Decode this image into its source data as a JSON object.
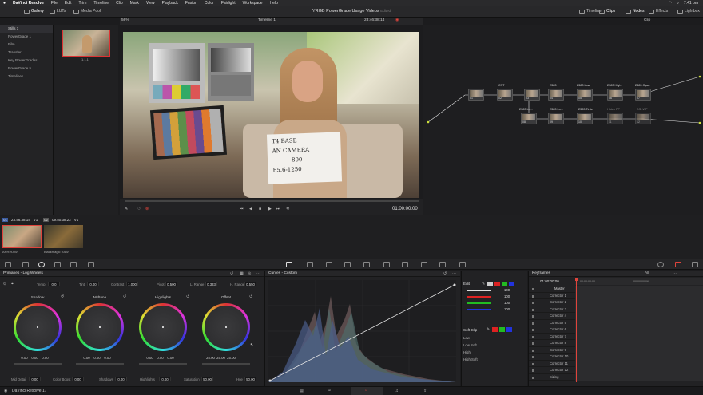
{
  "menubar": {
    "app": "DaVinci Resolve",
    "items": [
      "File",
      "Edit",
      "Trim",
      "Timeline",
      "Clip",
      "Mark",
      "View",
      "Playback",
      "Fusion",
      "Color",
      "Fairlight",
      "Workspace",
      "Help"
    ],
    "clock": "7:41 pm"
  },
  "topbar": {
    "gallery": "Gallery",
    "luts": "LUTs",
    "media_pool": "Media Pool",
    "zoom": "56%",
    "timeline_name": "Timeline 1",
    "timecode": "23:46:38:14",
    "project_title": "YRGB PowerGrade Usage Videos",
    "edited": "Edited",
    "timeline": "Timeline",
    "clips": "Clips",
    "nodes": "Nodes",
    "effects": "Effects",
    "lightbox": "Lightbox",
    "clip_mode": "Clip"
  },
  "stills": {
    "albums": [
      "Stills 1",
      "PowerGrade 1",
      "Film",
      "Transfer",
      "Key PowerGrades",
      "PowerGrade 5",
      "Timelines"
    ],
    "thumb_label": "1.1.1"
  },
  "viewer": {
    "timecode": "01:00:00:00",
    "sign_lines": [
      "T4 BASE",
      "AN CAMERA",
      "800",
      "F5.6-1250"
    ]
  },
  "nodes": [
    {
      "label": "",
      "num": "01"
    },
    {
      "label": "CST",
      "num": "02"
    },
    {
      "label": "",
      "num": "03"
    },
    {
      "label": "2383",
      "num": "04"
    },
    {
      "label": "2383 Low",
      "num": "05"
    },
    {
      "label": "2383 High",
      "num": "06"
    },
    {
      "label": "2383 Cyan",
      "num": "07"
    },
    {
      "label": "2383 Lo...",
      "num": "08"
    },
    {
      "label": "2383 Tints",
      "num": "09"
    },
    {
      "label": "2383 Tint",
      "num": "10"
    },
    {
      "label": "Hutch PP",
      "num": "11"
    },
    {
      "label": "DSI-WP",
      "num": "12"
    }
  ],
  "clips": [
    {
      "num": "01",
      "timecode": "23:46:38:14",
      "track": "V1",
      "codec": "ARRIRAW"
    },
    {
      "num": "02",
      "timecode": "09:50:38:22",
      "track": "V1",
      "codec": "Blackmagic RAW"
    }
  ],
  "primaries": {
    "title": "Primaries - Log Wheels",
    "temp_label": "Temp",
    "temp": "0.0",
    "tint_label": "Tint",
    "tint": "0.00",
    "contrast_label": "Contrast",
    "contrast": "1.000",
    "pivot_label": "Pivot",
    "pivot": "0.500",
    "lrange_label": "L. Range",
    "lrange": "0.333",
    "hrange_label": "H. Range",
    "hrange": "0.550",
    "wheels": [
      {
        "name": "Shadow",
        "vals": [
          "0.00",
          "0.00",
          "0.00"
        ]
      },
      {
        "name": "Midtone",
        "vals": [
          "0.00",
          "0.00",
          "0.00"
        ]
      },
      {
        "name": "Highlights",
        "vals": [
          "0.00",
          "0.00",
          "0.00"
        ]
      },
      {
        "name": "Offset",
        "vals": [
          "25.00",
          "25.00",
          "25.00"
        ]
      }
    ],
    "middetail_label": "Mid Detail",
    "middetail": "0.00",
    "colorboost_label": "Color Boost",
    "colorboost": "0.00",
    "shadows_label": "Shadows",
    "shadows": "0.00",
    "highlights_label": "Highlights",
    "highlights": "0.00",
    "saturation_label": "Saturation",
    "saturation": "50.00",
    "hue_label": "Hue",
    "hue": "50.00"
  },
  "curves": {
    "title": "Curves - Custom"
  },
  "edit": {
    "title": "Edit",
    "values": [
      "100",
      "100",
      "100",
      "100"
    ],
    "soft_clip": "Soft Clip",
    "low": "Low",
    "low_soft": "Low Soft",
    "high": "High",
    "high_soft": "High Soft"
  },
  "keyframes": {
    "title": "Keyframes",
    "filter": "All",
    "tc_main": "01:00:00:00",
    "tc_start": "00:00:00:00",
    "tc_end": "00:00:00:06",
    "rows": [
      "Master",
      "Corrector 1",
      "Corrector 2",
      "Corrector 3",
      "Corrector 4",
      "Corrector 5",
      "Corrector 6",
      "Corrector 7",
      "Corrector 8",
      "Corrector 9",
      "Corrector 10",
      "Corrector 11",
      "Corrector 12",
      "Sizing"
    ]
  },
  "bottombar": {
    "app": "DaVinci Resolve 17"
  },
  "colors": {
    "accent": "#e0443c",
    "panel": "#222224",
    "node_line": "#e6e6e6"
  }
}
